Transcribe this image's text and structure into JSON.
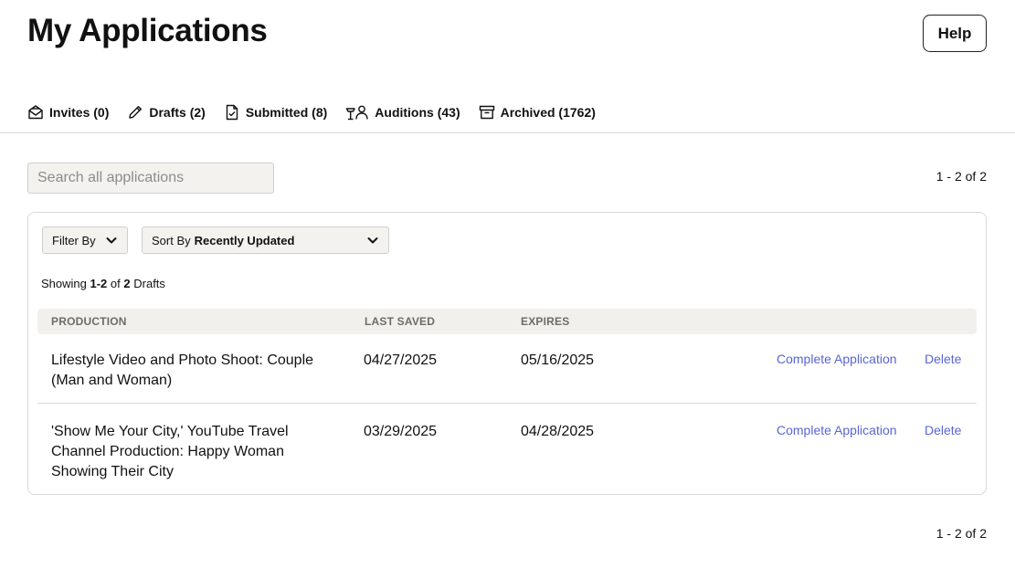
{
  "header": {
    "title": "My Applications",
    "help_label": "Help"
  },
  "tabs": [
    {
      "label": "Invites (0)",
      "icon": "envelope-icon"
    },
    {
      "label": "Drafts (2)",
      "icon": "pencil-icon"
    },
    {
      "label": "Submitted (8)",
      "icon": "document-check-icon"
    },
    {
      "label": "Auditions (43)",
      "icon": "audition-people-icon"
    },
    {
      "label": "Archived (1762)",
      "icon": "archive-box-icon"
    }
  ],
  "search": {
    "placeholder": "Search all applications",
    "value": ""
  },
  "pagination": {
    "top": "1 - 2 of 2",
    "bottom": "1 - 2 of 2"
  },
  "filters": {
    "filter_label": "Filter By",
    "sort_prefix": "Sort By",
    "sort_value": "Recently Updated"
  },
  "summary": {
    "prefix": "Showing",
    "range": "1-2",
    "of": "of",
    "total": "2",
    "noun": "Drafts"
  },
  "table": {
    "columns": [
      "PRODUCTION",
      "LAST SAVED",
      "EXPIRES"
    ],
    "rows": [
      {
        "production": "Lifestyle Video and Photo Shoot: Couple (Man and Woman)",
        "last_saved": "04/27/2025",
        "expires": "05/16/2025",
        "complete_label": "Complete Application",
        "delete_label": "Delete"
      },
      {
        "production": "'Show Me Your City,' YouTube Travel Channel Production: Happy Woman Showing Their City",
        "last_saved": "03/29/2025",
        "expires": "04/28/2025",
        "complete_label": "Complete Application",
        "delete_label": "Delete"
      }
    ]
  },
  "colors": {
    "link": "#5866d6",
    "header_bg": "#f1f0ec",
    "control_bg": "#f3f2ef"
  }
}
